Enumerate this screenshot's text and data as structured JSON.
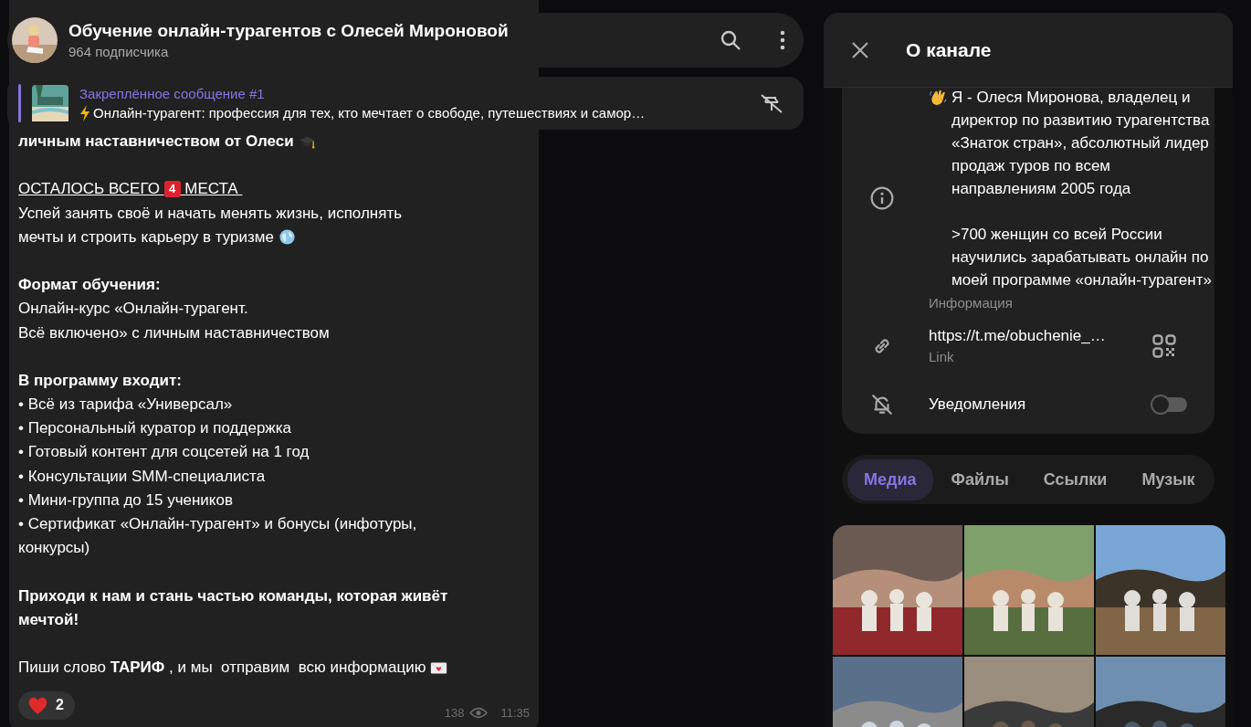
{
  "chat_header": {
    "title": "Обучение онлайн-турагентов с Олесей Мироновой",
    "subtitle": "964 подписчика"
  },
  "pinned": {
    "label": "Закреплённое сообщение #1",
    "text": "Онлайн-турагент: профессия для тех, кто мечтает о свободе, путешествиях и самор…"
  },
  "message": {
    "blocks": [
      [
        {
          "kind": "heading",
          "text": "личным наставничеством от Олеси"
        }
      ],
      [
        {
          "kind": "alert",
          "text": "ОСТАЛОСЬ ВСЕГО ",
          "badge": "4",
          "text_after": " МЕСТА "
        },
        {
          "kind": "text",
          "text": "Успей занять своё и начать менять жизнь, исполнять"
        },
        {
          "kind": "text",
          "text": "мечты и строить карьеру в туризме"
        }
      ],
      [
        {
          "kind": "heading",
          "text": "Формат обучения:"
        },
        {
          "kind": "text",
          "text": "Онлайн-курс «Онлайн-турагент."
        },
        {
          "kind": "text",
          "text": "Всё включено» с личным наставничеством"
        }
      ],
      [
        {
          "kind": "heading",
          "text": "В программу входит:"
        },
        {
          "kind": "text",
          "text": "• Всё из тарифа «Универсал»"
        },
        {
          "kind": "text",
          "text": "• Персональный куратор и поддержка"
        },
        {
          "kind": "text",
          "text": "• Готовый контент для соцсетей на 1 год"
        },
        {
          "kind": "text",
          "text": "• Консультации SMM-специалиста"
        },
        {
          "kind": "text",
          "text": "• Мини-группа до 15 учеников"
        },
        {
          "kind": "text",
          "text": "• Сертификат «Онлайн-турагент» и бонусы (инфотуры,"
        },
        {
          "kind": "text",
          "text": "конкурсы)"
        }
      ],
      [
        {
          "kind": "heading",
          "text": "Приходи к нам и стань частью команды, которая живёт"
        },
        {
          "kind": "heading",
          "text": "мечтой!"
        }
      ],
      [
        {
          "kind": "text",
          "text": "Пиши слово **ТАРИФ** , и мы  отправим  всю информацию"
        }
      ]
    ],
    "reaction": {
      "count": "2"
    },
    "views": "138",
    "time": "11:35"
  },
  "panel": {
    "title": "О канале",
    "info": {
      "text": "Я - Олеся Миронова, владелец и директор по развитию турагентства «Знаток стран», абсолютный лидер продаж туров по всем направлениям 2005 года\n\n>700 женщин со всей России научились зарабатывать онлайн по моей программе «онлайн-турагент»",
      "label": "Информация"
    },
    "link": {
      "value": "https://t.me/obuchenie_…",
      "label": "Link"
    },
    "notifications": {
      "label": "Уведомления",
      "on": false
    },
    "tabs": [
      {
        "label": "Медиа",
        "selected": true
      },
      {
        "label": "Файлы",
        "selected": false
      },
      {
        "label": "Ссылки",
        "selected": false
      },
      {
        "label": "Музык",
        "selected": false
      }
    ]
  }
}
